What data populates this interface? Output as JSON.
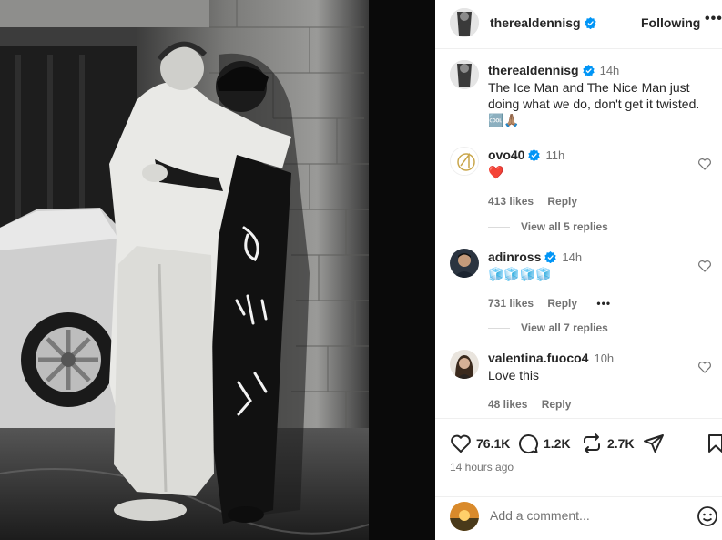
{
  "post": {
    "username": "therealdennisg",
    "follow_label": "Following",
    "more_label": "•••",
    "caption": {
      "username": "therealdennisg",
      "time": "14h",
      "text": "The Ice Man and The Nice Man just doing what we do, don't get it twisted.",
      "emojis": "🆒🙏🏽"
    }
  },
  "comments": [
    {
      "username": "ovo40",
      "time": "11h",
      "text": "❤️",
      "likes": "413 likes",
      "reply_label": "Reply",
      "view_replies": "View all 5 replies",
      "avatar_color": "#ffffff"
    },
    {
      "username": "adinross",
      "time": "14h",
      "text": "🧊🧊🧊🧊",
      "likes": "731 likes",
      "reply_label": "Reply",
      "more_label": "•••",
      "view_replies": "View all 7 replies",
      "avatar_color": "#2b3440"
    },
    {
      "username": "valentina.fuoco4",
      "time": "10h",
      "text": "Love this",
      "likes": "48 likes",
      "reply_label": "Reply",
      "avatar_color": "#6b5642"
    }
  ],
  "actions": {
    "like_count": "76.1K",
    "comment_count": "1.2K",
    "repost_count": "2.7K",
    "timestamp": "14 hours ago"
  },
  "composer": {
    "placeholder": "Add a comment..."
  },
  "icons": {
    "like": "heart-icon",
    "comment": "comment-icon",
    "repost": "repost-icon",
    "share": "share-icon",
    "save": "bookmark-icon",
    "emoji": "emoji-icon",
    "verified": "verified-badge-icon"
  },
  "colors": {
    "verified_blue": "#0095f6",
    "heart_red": "#ed4956",
    "secondary_text": "#737373"
  }
}
